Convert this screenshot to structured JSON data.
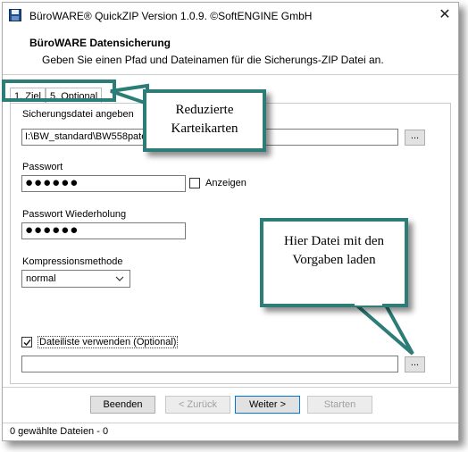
{
  "window": {
    "title": "BüroWARE® QuickZIP Version 1.0.9.   ©SoftENGINE GmbH",
    "close_glyph": "✕"
  },
  "header": {
    "title": "BüroWARE Datensicherung",
    "subtitle": "Geben Sie einen Pfad und Dateinamen für die Sicherungs-ZIP Datei an."
  },
  "tabs": [
    {
      "label": "1. Ziel",
      "selected": true
    },
    {
      "label": "5. Optional",
      "selected": false
    }
  ],
  "form": {
    "backup_file_label": "Sicherungsdatei angeben",
    "backup_file_value": "I:\\BW_standard\\BW558pate",
    "browse_label": "...",
    "password_label": "Passwort",
    "password_value": "●●●●●●",
    "show_label": "Anzeigen",
    "password_repeat_label": "Passwort Wiederholung",
    "password_repeat_value": "●●●●●●",
    "compression_label": "Kompressionsmethode",
    "compression_value": "normal",
    "filelist_label": "Dateiliste verwenden (Optional)",
    "filelist_checked": true,
    "filelist_value": "",
    "filelist_browse_label": "..."
  },
  "buttons": {
    "finish": "Beenden",
    "back": "< Zurück",
    "next": "Weiter >",
    "start": "Starten"
  },
  "status": {
    "text": "0 gewählte Dateien - 0"
  },
  "callouts": {
    "tabs_note": "Reduzierte Karteikarten",
    "file_note": "Hier Datei mit den Vorgaben laden"
  },
  "colors": {
    "callout_border": "#2c7d78",
    "focus_border": "#0078d7"
  },
  "icons": {
    "app": "floppy-disk-icon",
    "dropdown": "chevron-down-icon",
    "check": "checkmark-icon"
  }
}
